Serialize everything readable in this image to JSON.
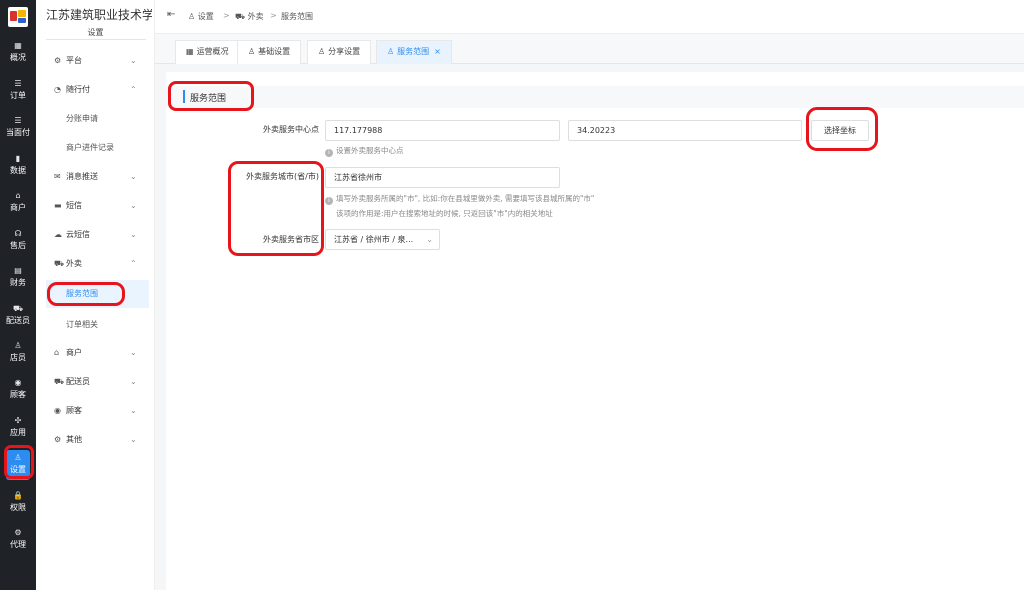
{
  "rail": {
    "items": [
      {
        "icon": "▦",
        "label": "概况"
      },
      {
        "icon": "☰",
        "label": "订单"
      },
      {
        "icon": "☰",
        "label": "当面付"
      },
      {
        "icon": "▮",
        "label": "数据"
      },
      {
        "icon": "⌂",
        "label": "商户"
      },
      {
        "icon": "☊",
        "label": "售后"
      },
      {
        "icon": "▤",
        "label": "财务"
      },
      {
        "icon": "⛟",
        "label": "配送员"
      },
      {
        "icon": "♙",
        "label": "店员"
      },
      {
        "icon": "◉",
        "label": "顾客"
      },
      {
        "icon": "✣",
        "label": "应用"
      },
      {
        "icon": "♙",
        "label": "设置"
      },
      {
        "icon": "🔒",
        "label": "权限"
      },
      {
        "icon": "⚙",
        "label": "代理"
      }
    ],
    "active_index": 11
  },
  "sidebar": {
    "title": "江苏建筑职业技术学院",
    "subtitle": "设置",
    "menu": [
      {
        "icon": "⚙",
        "label": "平台",
        "chevron": "⌄"
      },
      {
        "icon": "◔",
        "label": "随行付",
        "chevron": "⌃"
      },
      {
        "label": "分账申请"
      },
      {
        "label": "商户进件记录"
      },
      {
        "icon": "✉",
        "label": "消息推送",
        "chevron": "⌄"
      },
      {
        "icon": "▬",
        "label": "短信",
        "chevron": "⌄"
      },
      {
        "icon": "☁",
        "label": "云短信",
        "chevron": "⌄"
      },
      {
        "icon": "⛟",
        "label": "外卖",
        "chevron": "⌃"
      },
      {
        "label": "服务范围"
      },
      {
        "label": "订单相关"
      },
      {
        "icon": "⌂",
        "label": "商户",
        "chevron": "⌄"
      },
      {
        "icon": "⛟",
        "label": "配送员",
        "chevron": "⌄"
      },
      {
        "icon": "◉",
        "label": "顾客",
        "chevron": "⌄"
      },
      {
        "icon": "⚙",
        "label": "其他",
        "chevron": "⌄"
      }
    ]
  },
  "topbar": {
    "toggle_icon": "⇤",
    "breadcrumb": [
      {
        "icon": "♙",
        "label": "设置"
      },
      {
        "icon": "⛟",
        "label": "外卖"
      },
      {
        "label": "服务范围"
      }
    ],
    "separator": ">"
  },
  "tabs": [
    {
      "icon": "▦",
      "label": "运营概况"
    },
    {
      "icon": "♙",
      "label": "基础设置"
    },
    {
      "icon": "♙",
      "label": "分享设置"
    },
    {
      "icon": "♙",
      "label": "服务范围",
      "close": "×"
    }
  ],
  "main": {
    "section_title": "服务范围",
    "center_label": "外卖服务中心点",
    "longitude": "117.177988",
    "latitude": "34.20223",
    "pick_button": "选择坐标",
    "center_hint": "设置外卖服务中心点",
    "city_label": "外卖服务城市(省/市)",
    "city_value": "江苏省徐州市",
    "city_hint_1": "填写外卖服务所属的\"市\", 比如:你在县城里做外卖, 需要填写该县城所属的\"市\"",
    "city_hint_2": "该项的作用是:用户在搜索地址的时候, 只返回该\"市\"内的相关地址",
    "district_label": "外卖服务省市区",
    "district_value": "江苏省 / 徐州市 / 泉...",
    "hint_icon": "i",
    "chevron": "⌄"
  },
  "colors": {
    "accent": "#2d8cf0",
    "rail_bg": "#1f2227",
    "annotation": "#e8141b"
  }
}
